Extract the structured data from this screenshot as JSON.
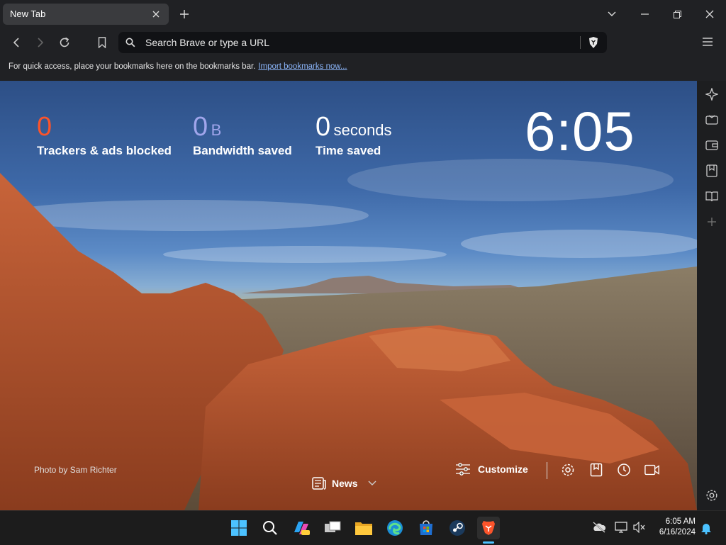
{
  "tab": {
    "title": "New Tab"
  },
  "omnibox": {
    "placeholder": "Search Brave or type a URL"
  },
  "bookmarks_bar": {
    "message": "For quick access, place your bookmarks here on the bookmarks bar.",
    "import_link": "Import bookmarks now..."
  },
  "stats": {
    "trackers": {
      "value": "0",
      "label": "Trackers & ads blocked",
      "color": "#fb542b"
    },
    "bandwidth": {
      "value": "0",
      "unit": "B",
      "label": "Bandwidth saved",
      "color": "#a0a5eb"
    },
    "time": {
      "value": "0",
      "unit": "seconds",
      "label": "Time saved"
    }
  },
  "clock": "6:05",
  "photo_credit": "Photo by Sam Richter",
  "news": {
    "label": "News"
  },
  "customize": {
    "label": "Customize"
  },
  "taskbar": {
    "time": "6:05 AM",
    "date": "6/16/2024",
    "apps": [
      "windows-start",
      "search",
      "copilot",
      "task-view",
      "file-explorer",
      "edge",
      "microsoft-store",
      "steam",
      "brave"
    ]
  },
  "colors": {
    "brave_orange": "#fb542b",
    "accent": "#4cc2ff"
  }
}
